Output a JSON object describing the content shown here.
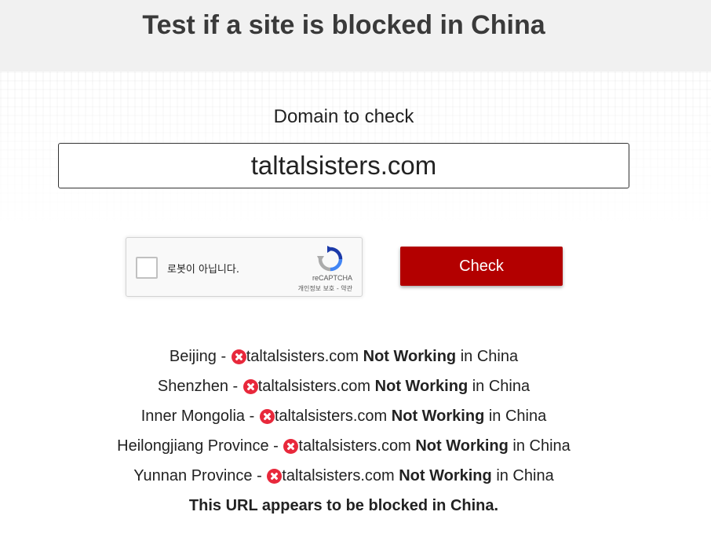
{
  "header": {
    "title": "Test if a site is blocked in China"
  },
  "form": {
    "domain_label": "Domain to check",
    "domain_value": "taltalsisters.com",
    "check_label": "Check"
  },
  "recaptcha": {
    "label": "로봇이 아닙니다.",
    "brand": "reCAPTCHA",
    "terms": "개인정보 보호 - 약관"
  },
  "results": [
    {
      "location": "Beijing",
      "domain": "taltalsisters.com",
      "status": "Not Working",
      "suffix": "in China"
    },
    {
      "location": "Shenzhen",
      "domain": "taltalsisters.com",
      "status": "Not Working",
      "suffix": "in China"
    },
    {
      "location": "Inner Mongolia",
      "domain": "taltalsisters.com",
      "status": "Not Working",
      "suffix": "in China"
    },
    {
      "location": "Heilongjiang Province",
      "domain": "taltalsisters.com",
      "status": "Not Working",
      "suffix": "in China"
    },
    {
      "location": "Yunnan Province",
      "domain": "taltalsisters.com",
      "status": "Not Working",
      "suffix": "in China"
    }
  ],
  "verdict": "This URL appears to be blocked in China.",
  "colors": {
    "accent": "#b30000",
    "error": "#e8283b",
    "header_bg": "#f1f1f1"
  }
}
